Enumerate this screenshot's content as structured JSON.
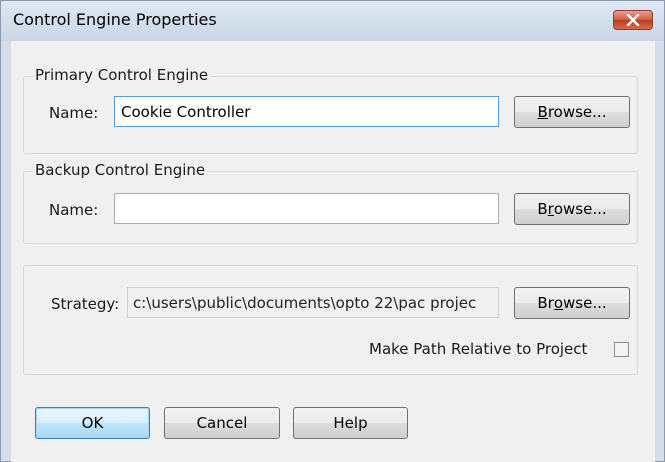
{
  "window": {
    "title": "Control Engine Properties"
  },
  "primary": {
    "group_label": "Primary Control Engine",
    "name_label": "Name:",
    "name_value": "Cookie Controller",
    "browse_label_pre": "",
    "browse_label_key": "B",
    "browse_label_post": "rowse..."
  },
  "backup": {
    "group_label": "Backup Control Engine",
    "name_label": "Name:",
    "name_value": "",
    "browse_label_pre": "B",
    "browse_label_key": "r",
    "browse_label_post": "owse..."
  },
  "strategy": {
    "label": "Strategy:",
    "path_value": "c:\\users\\public\\documents\\opto 22\\pac projec",
    "browse_label_pre": "Br",
    "browse_label_key": "o",
    "browse_label_post": "wse...",
    "relative_label": "Make Path Relative to Project",
    "relative_checked": false
  },
  "footer": {
    "ok_label": "OK",
    "cancel_label": "Cancel",
    "help_label": "Help"
  }
}
